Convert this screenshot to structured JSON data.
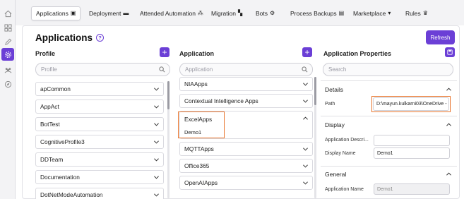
{
  "tabs": [
    {
      "label": "Applications",
      "icon": "▣"
    },
    {
      "label": "Deployment",
      "icon": "▬"
    },
    {
      "label": "Attended Automation",
      "icon": "⁂"
    },
    {
      "label": "Migration",
      "icon": "▚"
    },
    {
      "label": "Bots",
      "icon": "⚙"
    },
    {
      "label": "Process Backups",
      "icon": "▤"
    },
    {
      "label": "Marketplace",
      "icon": "▾"
    },
    {
      "label": "Rules",
      "icon": "♛"
    }
  ],
  "page": {
    "title": "Applications",
    "help": "?",
    "refresh_label": "Refresh"
  },
  "profile": {
    "title": "Profile",
    "search_placeholder": "Profile",
    "items": [
      "apCommon",
      "AppAct",
      "BotTest",
      "CognitiveProfile3",
      "DDTeam",
      "Documentation",
      "DotNetModeAutomation"
    ]
  },
  "application": {
    "title": "Application",
    "search_placeholder": "Application",
    "items": [
      {
        "label": "NIAApps"
      },
      {
        "label": "Contextual Intelligence Apps"
      },
      {
        "label": "ExcelApps",
        "child": "Demo1"
      },
      {
        "label": "MQTTApps"
      },
      {
        "label": "Office365"
      },
      {
        "label": "OpenAIApps"
      }
    ]
  },
  "properties": {
    "title": "Application Properties",
    "search_placeholder": "Search",
    "details": {
      "title": "Details",
      "path_label": "Path",
      "path_value": "D:\\mayun.kulkarni03\\OneDrive -"
    },
    "display": {
      "title": "Display",
      "desc_label": "Application Descri...",
      "desc_value": "",
      "name_label": "Display Name",
      "name_value": "Demo1"
    },
    "general": {
      "title": "General",
      "app_name_label": "Application Name",
      "app_name_value": "Demo1"
    }
  },
  "colors": {
    "accent": "#6b3fd6",
    "highlight": "#e8742c"
  }
}
